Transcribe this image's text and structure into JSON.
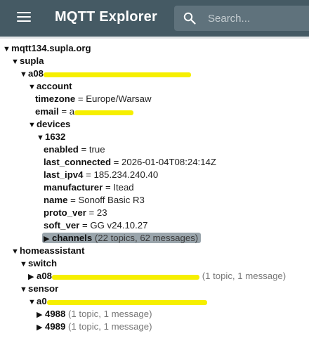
{
  "app": {
    "title": "MQTT Explorer",
    "search_placeholder": "Search...",
    "menu_icon": "hamburger-menu-icon",
    "search_icon": "magnifier-icon"
  },
  "tree": {
    "broker": "mqtt134.supla.org",
    "supla": {
      "label": "supla",
      "client_prefix": "a08",
      "account": {
        "label": "account",
        "timezone_key": "timezone",
        "timezone_value": "Europe/Warsaw",
        "email_key": "email",
        "email_prefix": "a"
      },
      "devices": {
        "label": "devices",
        "device_id": "1632",
        "fields": [
          {
            "key": "enabled",
            "value": "true"
          },
          {
            "key": "last_connected",
            "value": "2026-01-04T08:24:14Z"
          },
          {
            "key": "last_ipv4",
            "value": "185.234.240.40"
          },
          {
            "key": "manufacturer",
            "value": "Itead"
          },
          {
            "key": "name",
            "value": "Sonoff Basic R3"
          },
          {
            "key": "proto_ver",
            "value": "23"
          },
          {
            "key": "soft_ver",
            "value": "GG v24.10.27"
          }
        ],
        "channels": {
          "label": "channels",
          "summary": "(22 topics, 62 messages)"
        }
      }
    },
    "homeassistant": {
      "label": "homeassistant",
      "switch": {
        "label": "switch",
        "item_prefix": "a08",
        "summary": "(1 topic, 1 message)"
      },
      "sensor": {
        "label": "sensor",
        "item_prefix": "a0",
        "children": [
          {
            "label": "4988",
            "summary": "(1 topic, 1 message)"
          },
          {
            "label": "4989",
            "summary": "(1 topic, 1 message)"
          }
        ]
      }
    }
  },
  "colors": {
    "appbar": "#455a64",
    "search_bg": "#5f727c",
    "redaction": "#f6ef00",
    "selected": "#9aa5ac"
  }
}
